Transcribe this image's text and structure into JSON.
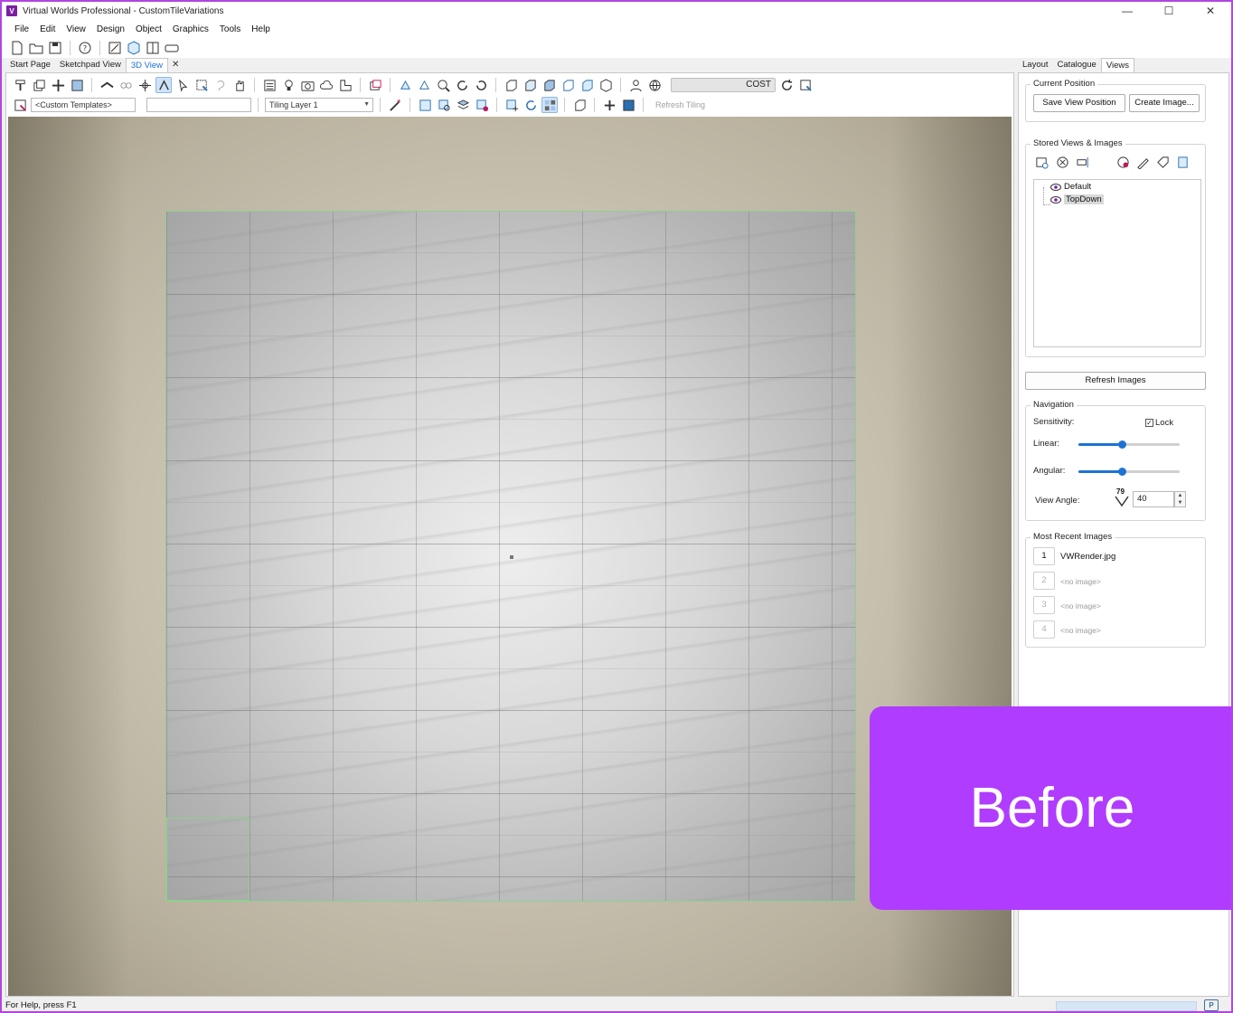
{
  "window": {
    "title": "Virtual Worlds Professional - CustomTileVariations",
    "logo_letter": "V",
    "controls": [
      "—",
      "☐",
      "✕"
    ]
  },
  "menu": [
    "File",
    "Edit",
    "View",
    "Design",
    "Object",
    "Graphics",
    "Tools",
    "Help"
  ],
  "doc_tabs": {
    "start_page": "Start Page",
    "sketchpad_view": "Sketchpad View",
    "view_3d": "3D View",
    "close": "✕"
  },
  "toolbar": {
    "cost_label": "COST",
    "template_combo": "<Custom Templates>",
    "blank_combo": "",
    "tiling_layer_combo": "Tiling Layer 1",
    "refresh_tiling": "Refresh Tiling"
  },
  "side_tabs": {
    "layout": "Layout",
    "catalogue": "Catalogue",
    "views": "Views"
  },
  "current_position": {
    "label": "Current Position",
    "save_view_position": "Save View Position",
    "create_image": "Create Image..."
  },
  "stored_views": {
    "label": "Stored Views & Images",
    "items": [
      {
        "label": "Default",
        "selected": false
      },
      {
        "label": "TopDown",
        "selected": true
      }
    ]
  },
  "refresh_images": "Refresh Images",
  "navigation": {
    "label": "Navigation",
    "sensitivity": "Sensitivity:",
    "lock": "Lock",
    "lock_checked": true,
    "linear": "Linear:",
    "linear_fraction": 0.43,
    "angular": "Angular:",
    "angular_fraction": 0.43,
    "view_angle": "View Angle:",
    "view_angle_icon_value": "79",
    "view_angle_value": "40"
  },
  "recent_images": {
    "label": "Most Recent Images",
    "items": [
      {
        "num": "1",
        "name": "VWRender.jpg",
        "empty": false
      },
      {
        "num": "2",
        "name": "<no image>",
        "empty": true
      },
      {
        "num": "3",
        "name": "<no image>",
        "empty": true
      },
      {
        "num": "4",
        "name": "<no image>",
        "empty": true
      }
    ]
  },
  "status": {
    "help_text": "For Help, press F1",
    "indicator": "P"
  },
  "banner": {
    "text": "Before",
    "color": "#b03cff"
  },
  "colors": {
    "accent": "#1e73d2",
    "tab_active_text": "#1f6fd1",
    "floor_outline": "#8fd08f"
  }
}
